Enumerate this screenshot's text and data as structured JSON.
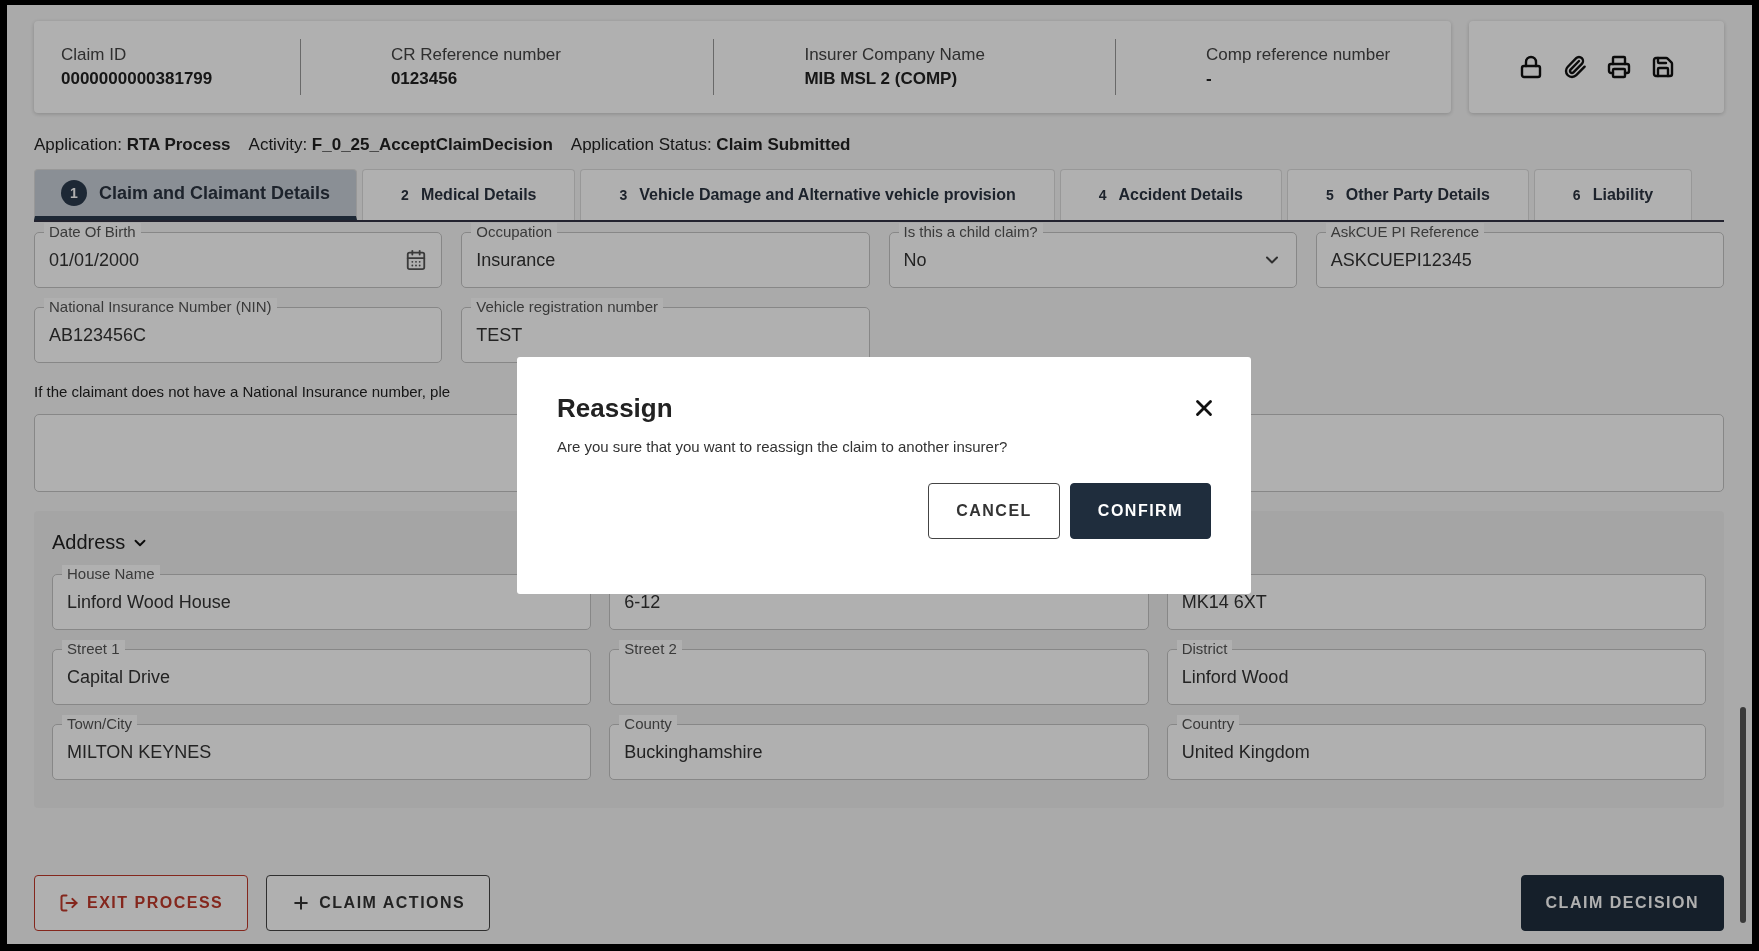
{
  "header": {
    "items": [
      {
        "label": "Claim ID",
        "value": "0000000000381799"
      },
      {
        "label": "CR Reference number",
        "value": "0123456"
      },
      {
        "label": "Insurer Company Name",
        "value": "MIB MSL 2 (COMP)"
      },
      {
        "label": "Comp reference number",
        "value": "-"
      }
    ]
  },
  "info": [
    {
      "label": "Application:",
      "value": "RTA Process"
    },
    {
      "label": "Activity:",
      "value": "F_0_25_AcceptClaimDecision"
    },
    {
      "label": "Application Status:",
      "value": "Claim Submitted"
    }
  ],
  "tabs": [
    {
      "number": "1",
      "label": "Claim and Claimant Details",
      "selected": true
    },
    {
      "number": "2",
      "label": "Medical Details",
      "selected": false
    },
    {
      "number": "3",
      "label": "Vehicle Damage and Alternative vehicle provision",
      "selected": false
    },
    {
      "number": "4",
      "label": "Accident Details",
      "selected": false
    },
    {
      "number": "5",
      "label": "Other Party Details",
      "selected": false
    },
    {
      "number": "6",
      "label": "Liability",
      "selected": false
    }
  ],
  "fields": [
    {
      "kind": "date",
      "label": "Date Of Birth",
      "value": "01/01/2000"
    },
    {
      "kind": "text",
      "label": "Occupation",
      "value": "Insurance"
    },
    {
      "kind": "select",
      "label": "Is this a child claim?",
      "value": "No"
    },
    {
      "kind": "text",
      "label": "AskCUE PI Reference",
      "value": "ASKCUEPI12345"
    },
    {
      "kind": "text",
      "label": "National Insurance Number (NIN)",
      "value": "AB123456C"
    },
    {
      "kind": "text",
      "label": "Vehicle registration number",
      "value": "TEST"
    }
  ],
  "helper_text": "If the claimant does not have a National Insurance number, ple",
  "address": {
    "title": "Address",
    "expanded": true,
    "fields": [
      {
        "label": "House Name",
        "value": "Linford Wood House"
      },
      {
        "value": "6-12"
      },
      {
        "value": "MK14 6XT"
      },
      {
        "label": "Street 1",
        "value": "Capital Drive"
      },
      {
        "label": "Street 2"
      },
      {
        "label": "District",
        "value": "Linford Wood"
      },
      {
        "label": "Town/City",
        "value": "MILTON KEYNES"
      },
      {
        "label": "County",
        "value": "Buckinghamshire"
      },
      {
        "label": "Country",
        "value": "United Kingdom"
      }
    ]
  },
  "buttons": {
    "exit": "EXIT PROCESS",
    "actions": "CLAIM ACTIONS",
    "decision": "CLAIM DECISION"
  },
  "dialog": {
    "title": "Reassign",
    "message": "Are you sure that you want to reassign the claim to another insurer?",
    "cancel": "CANCEL",
    "confirm": "CONFIRM"
  }
}
